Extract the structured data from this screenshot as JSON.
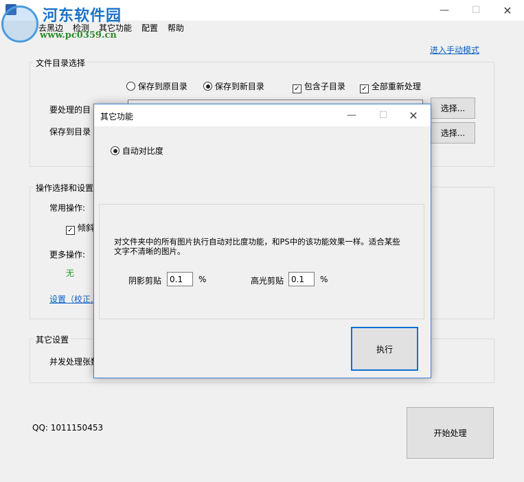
{
  "main": {
    "menu": [
      "去黑边",
      "检测",
      "其它功能",
      "配置",
      "帮助"
    ],
    "manual_mode_link": "进入手动模式",
    "file_group_label": "文件目录选择",
    "radio_save_original": "保存到原目录",
    "radio_save_new": "保存到新目录",
    "check_include_subdir": "包含子目录",
    "check_reprocess_all": "全部重新处理",
    "src_dir_label": "要处理的目",
    "dst_dir_label": "保存到目录",
    "select_btn_1": "选择...",
    "select_btn_2": "选择...",
    "ops_group_label": "操作选择和设置",
    "common_ops_label": "常用操作:",
    "deskew_label": "倾斜",
    "more_ops_label": "更多操作:",
    "more_ops_value": "无",
    "settings_link": "设置（校正,",
    "other_group_label": "其它设置",
    "concurrency_label": "并发处理张数",
    "qq_text": "QQ: 1011150453",
    "start_btn": "开始处理"
  },
  "watermark": {
    "site_name": "河东软件园",
    "site_url": "www.pc0359.cn"
  },
  "dialog": {
    "title": "其它功能",
    "radio_auto_contrast": "自动对比度",
    "description": "对文件夹中的所有图片执行自动对比度功能，和PS中的该功能效果一样。适合某些文字不清晰的图片。",
    "shadow_clip_label": "阴影剪贴",
    "shadow_clip_value": "0.1",
    "highlight_clip_label": "高光剪贴",
    "highlight_clip_value": "0.1",
    "percent": "%",
    "run_btn": "执行"
  }
}
